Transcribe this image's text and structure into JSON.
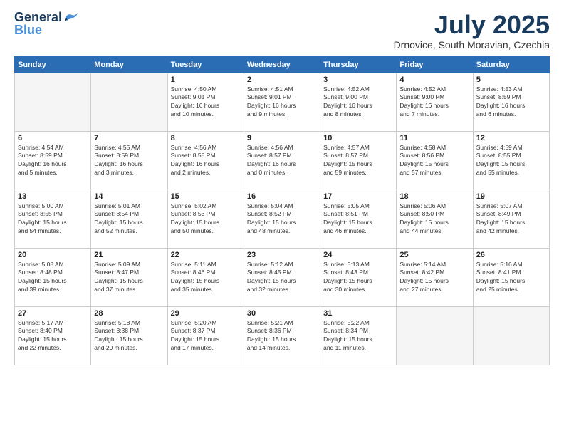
{
  "header": {
    "logo_line1": "General",
    "logo_line2": "Blue",
    "month": "July 2025",
    "location": "Drnovice, South Moravian, Czechia"
  },
  "weekdays": [
    "Sunday",
    "Monday",
    "Tuesday",
    "Wednesday",
    "Thursday",
    "Friday",
    "Saturday"
  ],
  "weeks": [
    [
      {
        "day": "",
        "info": ""
      },
      {
        "day": "",
        "info": ""
      },
      {
        "day": "1",
        "info": "Sunrise: 4:50 AM\nSunset: 9:01 PM\nDaylight: 16 hours\nand 10 minutes."
      },
      {
        "day": "2",
        "info": "Sunrise: 4:51 AM\nSunset: 9:01 PM\nDaylight: 16 hours\nand 9 minutes."
      },
      {
        "day": "3",
        "info": "Sunrise: 4:52 AM\nSunset: 9:00 PM\nDaylight: 16 hours\nand 8 minutes."
      },
      {
        "day": "4",
        "info": "Sunrise: 4:52 AM\nSunset: 9:00 PM\nDaylight: 16 hours\nand 7 minutes."
      },
      {
        "day": "5",
        "info": "Sunrise: 4:53 AM\nSunset: 8:59 PM\nDaylight: 16 hours\nand 6 minutes."
      }
    ],
    [
      {
        "day": "6",
        "info": "Sunrise: 4:54 AM\nSunset: 8:59 PM\nDaylight: 16 hours\nand 5 minutes."
      },
      {
        "day": "7",
        "info": "Sunrise: 4:55 AM\nSunset: 8:59 PM\nDaylight: 16 hours\nand 3 minutes."
      },
      {
        "day": "8",
        "info": "Sunrise: 4:56 AM\nSunset: 8:58 PM\nDaylight: 16 hours\nand 2 minutes."
      },
      {
        "day": "9",
        "info": "Sunrise: 4:56 AM\nSunset: 8:57 PM\nDaylight: 16 hours\nand 0 minutes."
      },
      {
        "day": "10",
        "info": "Sunrise: 4:57 AM\nSunset: 8:57 PM\nDaylight: 15 hours\nand 59 minutes."
      },
      {
        "day": "11",
        "info": "Sunrise: 4:58 AM\nSunset: 8:56 PM\nDaylight: 15 hours\nand 57 minutes."
      },
      {
        "day": "12",
        "info": "Sunrise: 4:59 AM\nSunset: 8:55 PM\nDaylight: 15 hours\nand 55 minutes."
      }
    ],
    [
      {
        "day": "13",
        "info": "Sunrise: 5:00 AM\nSunset: 8:55 PM\nDaylight: 15 hours\nand 54 minutes."
      },
      {
        "day": "14",
        "info": "Sunrise: 5:01 AM\nSunset: 8:54 PM\nDaylight: 15 hours\nand 52 minutes."
      },
      {
        "day": "15",
        "info": "Sunrise: 5:02 AM\nSunset: 8:53 PM\nDaylight: 15 hours\nand 50 minutes."
      },
      {
        "day": "16",
        "info": "Sunrise: 5:04 AM\nSunset: 8:52 PM\nDaylight: 15 hours\nand 48 minutes."
      },
      {
        "day": "17",
        "info": "Sunrise: 5:05 AM\nSunset: 8:51 PM\nDaylight: 15 hours\nand 46 minutes."
      },
      {
        "day": "18",
        "info": "Sunrise: 5:06 AM\nSunset: 8:50 PM\nDaylight: 15 hours\nand 44 minutes."
      },
      {
        "day": "19",
        "info": "Sunrise: 5:07 AM\nSunset: 8:49 PM\nDaylight: 15 hours\nand 42 minutes."
      }
    ],
    [
      {
        "day": "20",
        "info": "Sunrise: 5:08 AM\nSunset: 8:48 PM\nDaylight: 15 hours\nand 39 minutes."
      },
      {
        "day": "21",
        "info": "Sunrise: 5:09 AM\nSunset: 8:47 PM\nDaylight: 15 hours\nand 37 minutes."
      },
      {
        "day": "22",
        "info": "Sunrise: 5:11 AM\nSunset: 8:46 PM\nDaylight: 15 hours\nand 35 minutes."
      },
      {
        "day": "23",
        "info": "Sunrise: 5:12 AM\nSunset: 8:45 PM\nDaylight: 15 hours\nand 32 minutes."
      },
      {
        "day": "24",
        "info": "Sunrise: 5:13 AM\nSunset: 8:43 PM\nDaylight: 15 hours\nand 30 minutes."
      },
      {
        "day": "25",
        "info": "Sunrise: 5:14 AM\nSunset: 8:42 PM\nDaylight: 15 hours\nand 27 minutes."
      },
      {
        "day": "26",
        "info": "Sunrise: 5:16 AM\nSunset: 8:41 PM\nDaylight: 15 hours\nand 25 minutes."
      }
    ],
    [
      {
        "day": "27",
        "info": "Sunrise: 5:17 AM\nSunset: 8:40 PM\nDaylight: 15 hours\nand 22 minutes."
      },
      {
        "day": "28",
        "info": "Sunrise: 5:18 AM\nSunset: 8:38 PM\nDaylight: 15 hours\nand 20 minutes."
      },
      {
        "day": "29",
        "info": "Sunrise: 5:20 AM\nSunset: 8:37 PM\nDaylight: 15 hours\nand 17 minutes."
      },
      {
        "day": "30",
        "info": "Sunrise: 5:21 AM\nSunset: 8:36 PM\nDaylight: 15 hours\nand 14 minutes."
      },
      {
        "day": "31",
        "info": "Sunrise: 5:22 AM\nSunset: 8:34 PM\nDaylight: 15 hours\nand 11 minutes."
      },
      {
        "day": "",
        "info": ""
      },
      {
        "day": "",
        "info": ""
      }
    ]
  ]
}
